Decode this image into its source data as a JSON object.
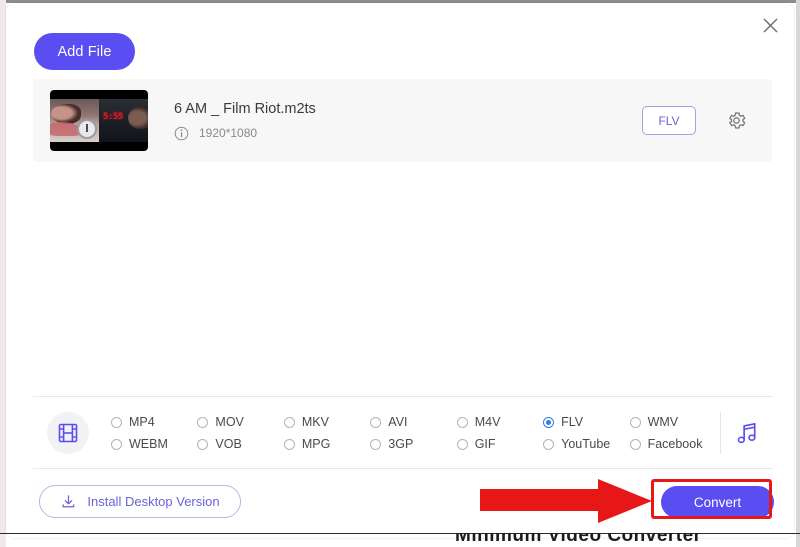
{
  "window": {
    "close_label": "×",
    "close_icon": "close-icon"
  },
  "toolbar": {
    "add_file_label": "Add File"
  },
  "file_row": {
    "name": "6 AM _ Film Riot.m2ts",
    "info_icon": "info-icon",
    "resolution": "1920*1080",
    "output_format_tag": "FLV",
    "settings_icon": "gear-icon",
    "thumbnail": {
      "icon": "video-thumbnail",
      "clock_digits": "5:55"
    }
  },
  "format_bar": {
    "video_icon": "film-strip-icon",
    "audio_icon": "music-note-icon",
    "selected": "FLV",
    "options": [
      {
        "label": "MP4",
        "selected": false
      },
      {
        "label": "MOV",
        "selected": false
      },
      {
        "label": "MKV",
        "selected": false
      },
      {
        "label": "AVI",
        "selected": false
      },
      {
        "label": "M4V",
        "selected": false
      },
      {
        "label": "FLV",
        "selected": true
      },
      {
        "label": "WMV",
        "selected": false
      },
      {
        "label": "WEBM",
        "selected": false
      },
      {
        "label": "VOB",
        "selected": false
      },
      {
        "label": "MPG",
        "selected": false
      },
      {
        "label": "3GP",
        "selected": false
      },
      {
        "label": "GIF",
        "selected": false
      },
      {
        "label": "YouTube",
        "selected": false
      },
      {
        "label": "Facebook",
        "selected": false
      }
    ]
  },
  "footer": {
    "install_label": "Install Desktop Version",
    "install_icon": "download-icon",
    "convert_label": "Convert"
  },
  "annotations": {
    "highlight_color": "#e81717",
    "arrow_icon": "red-arrow-right"
  },
  "page_caption": {
    "text": "Minimum Video Converter"
  },
  "colors": {
    "accent": "#5a4df2",
    "accent_soft": "#6a62d8",
    "radio_selected": "#2f7fe6",
    "row_bg": "#f7f7f7",
    "annotation_red": "#e81717"
  }
}
